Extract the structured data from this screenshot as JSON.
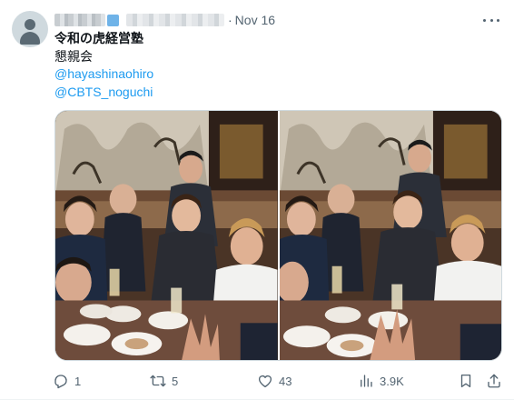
{
  "author": {
    "avatar_icon": "default-avatar-icon",
    "separator": "·",
    "date": "Nov 16"
  },
  "post": {
    "title": "令和の虎経営塾",
    "line1": "懇親会",
    "mention1": "@hayashinaohiro",
    "mention2": "@CBTS_noguchi"
  },
  "media": {
    "photos": [
      "group-photo-1",
      "group-photo-2"
    ]
  },
  "actions": {
    "reply_icon": "reply-icon",
    "reply_count": "1",
    "repost_icon": "repost-icon",
    "repost_count": "5",
    "like_icon": "heart-icon",
    "like_count": "43",
    "views_icon": "views-chart-icon",
    "views_count": "3.9K",
    "bookmark_icon": "bookmark-icon",
    "share_icon": "share-icon"
  },
  "colors": {
    "link": "#1d9bf0",
    "secondary_text": "#536471",
    "text": "#0f1419"
  }
}
